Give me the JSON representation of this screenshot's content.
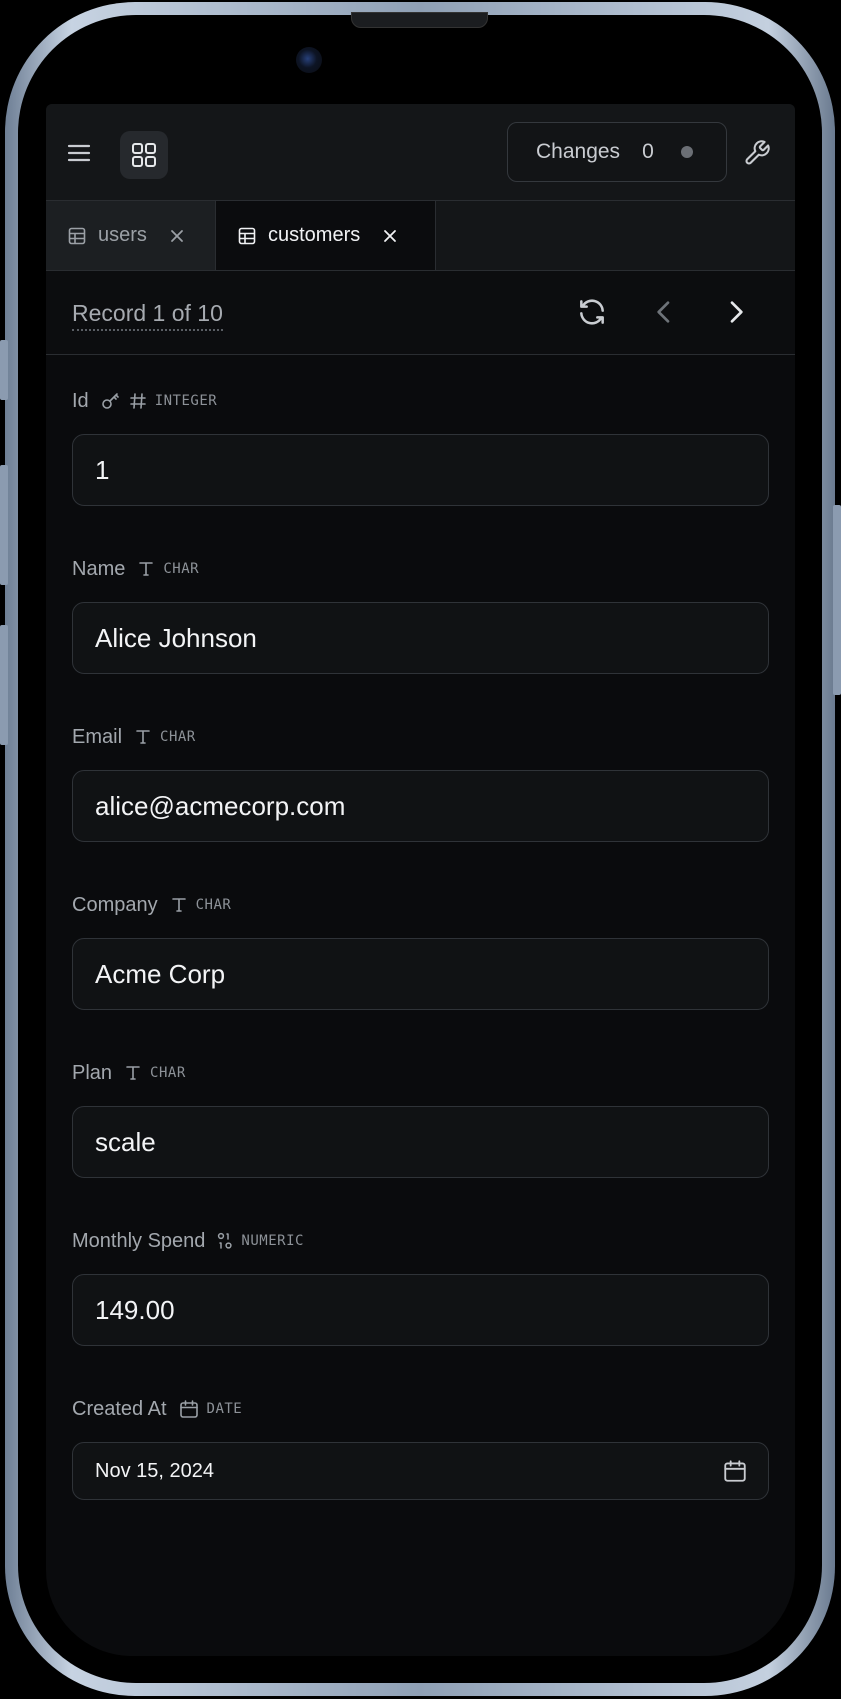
{
  "toolbar": {
    "menu_icon": "menu-icon",
    "grid_icon": "grid-icon",
    "changes_label": "Changes",
    "changes_count": "0",
    "settings_icon": "wrench-icon"
  },
  "tabs": [
    {
      "label": "users",
      "icon": "table-icon",
      "active": false
    },
    {
      "label": "customers",
      "icon": "table-icon",
      "active": true
    }
  ],
  "record": {
    "label": "Record 1 of 10",
    "refresh_icon": "refresh-icon",
    "prev_icon": "chevron-left-icon",
    "next_icon": "chevron-right-icon"
  },
  "fields": [
    {
      "label": "Id",
      "type": "INTEGER",
      "icons": [
        "key-icon",
        "hash-icon"
      ],
      "value": "1"
    },
    {
      "label": "Name",
      "type": "CHAR",
      "icons": [
        "text-type-icon"
      ],
      "value": "Alice Johnson"
    },
    {
      "label": "Email",
      "type": "CHAR",
      "icons": [
        "text-type-icon"
      ],
      "value": "alice@acmecorp.com"
    },
    {
      "label": "Company",
      "type": "CHAR",
      "icons": [
        "text-type-icon"
      ],
      "value": "Acme Corp"
    },
    {
      "label": "Plan",
      "type": "CHAR",
      "icons": [
        "text-type-icon"
      ],
      "value": "scale"
    },
    {
      "label": "Monthly Spend",
      "type": "NUMERIC",
      "icons": [
        "numeric-icon"
      ],
      "value": "149.00"
    },
    {
      "label": "Created At",
      "type": "DATE",
      "icons": [
        "calendar-icon"
      ],
      "value": "Nov 15, 2024"
    }
  ],
  "colors": {
    "background": "#0a0b0d",
    "panel": "#141618",
    "border": "#2f3338",
    "text": "#f3f4f6",
    "muted": "#a3a8ae"
  }
}
